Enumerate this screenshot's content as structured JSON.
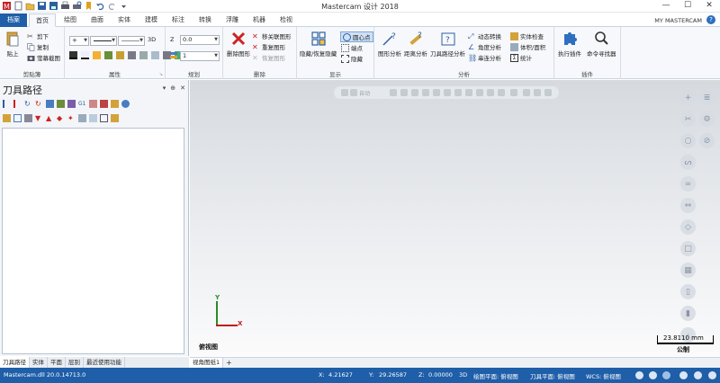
{
  "title": "Mastercam 设计 2018",
  "quick_access": [
    "mastercam-logo",
    "new-file-icon",
    "open-file-icon",
    "save-icon",
    "save-as-icon",
    "print-icon",
    "print-preview-icon",
    "bookmark-icon",
    "undo-icon",
    "redo-icon",
    "customize-icon"
  ],
  "window_controls": {
    "minimize": "—",
    "maximize": "☐",
    "close": "✕"
  },
  "tabs": [
    "档案",
    "首页",
    "绘图",
    "曲面",
    "实体",
    "建模",
    "标注",
    "转换",
    "浮雕",
    "机器",
    "检视"
  ],
  "active_tab": "首页",
  "account": "MY MASTERCAM",
  "help": "?",
  "ribbon": {
    "clipboard": {
      "label": "剪贴簿",
      "paste": "贴上",
      "cut": "剪下",
      "copy": "复制",
      "screenshot": "萤幕截图"
    },
    "properties": {
      "label": "属性",
      "level_3d": "3D"
    },
    "planning": {
      "label": "规划",
      "z_label": "Z",
      "z_value": "0.0",
      "level_value": "1"
    },
    "delete": {
      "label": "删除",
      "delete_entities": "删除图形",
      "delete_duplicates": "移关联图形",
      "repeat": "重复图形",
      "undelete": "恢复图形"
    },
    "display": {
      "label": "显示",
      "hide": "隐藏/恢复隐藏",
      "arc_center": "圆心点",
      "endpoints": "端点",
      "hide2": "隐藏"
    },
    "analysis": {
      "label": "分析",
      "entity": "图形分析",
      "distance": "距离分析",
      "toolpath": "刀具路径分析",
      "dynamic": "动态转换",
      "angle": "角度分析",
      "chain": "串连分析",
      "solid_check": "实体检查",
      "volume": "体积/面积",
      "stats": "统计"
    },
    "addins": {
      "label": "插件",
      "run": "执行插件",
      "finder": "命令寻找器"
    }
  },
  "panel": {
    "title": "刀具路径",
    "controls": [
      "▾",
      "⊕",
      "✕"
    ],
    "bottom_tabs": [
      "刀具路径",
      "实体",
      "平面",
      "层别",
      "最近使用功能"
    ]
  },
  "viewport": {
    "toolbar_label": "自动",
    "axis_x": "X",
    "axis_y": "Y",
    "view_name": "俯视图",
    "scale_value": "23.8110 mm",
    "scale_unit": "公制"
  },
  "sheet_tabs": {
    "sheet": "视角图纸1",
    "add": "+"
  },
  "status": {
    "version": "Mastercam.dll 20.0.14713.0",
    "x_label": "X:",
    "x_value": "4.21627",
    "y_label": "Y:",
    "y_value": "29.26587",
    "z_label": "Z:",
    "z_value": "0.00000",
    "mode": "3D",
    "cplane": "绘图平面: 俯视图",
    "tplane": "刀具平面: 俯视图",
    "wcs": "WCS: 俯视图"
  },
  "colors": {
    "accent": "#1f5ea8",
    "x_axis": "#c01818",
    "y_axis": "#2a8a2a",
    "delete_red": "#cc2222"
  }
}
